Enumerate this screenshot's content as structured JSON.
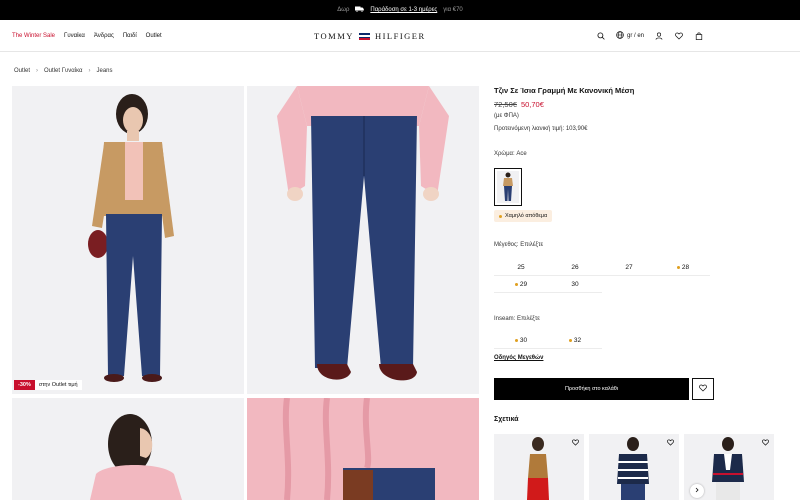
{
  "promo_bar": {
    "left": "Δωρ",
    "link": "Παράδοση σε 1-3 ημέρες",
    "right": "για €70"
  },
  "nav": {
    "sale": "The Winter Sale",
    "women": "Γυναίκα",
    "men": "Άνδρας",
    "kids": "Παιδί",
    "outlet": "Outlet"
  },
  "logo": {
    "left": "TOMMY",
    "right": "HILFIGER",
    "flag_colors": [
      "#0a2a6b",
      "#ffffff",
      "#c8102e"
    ]
  },
  "header_icons": {
    "lang": "gr / en",
    "icons": [
      "search-icon",
      "globe-icon",
      "account-icon",
      "heart-icon",
      "bag-icon"
    ]
  },
  "breadcrumb": [
    "Outlet",
    "Outlet Γυναίκα",
    "Jeans"
  ],
  "gallery_promo": {
    "badge": "-30%",
    "text": "στην Outlet τιμή"
  },
  "product": {
    "title": "Τζιν Σε Ίσια Γραμμή Με Κανονική Μέση",
    "old_price": "72,50€",
    "new_price": "50,70€",
    "vat": "(με ΦΠΑ)",
    "rrp": "Προτεινόμενη λιανική τιμή: 103,90€",
    "color_label": "Χρώμα: Ace",
    "stock": "Χαμηλό απόθεμα",
    "size_label": "Μέγεθος: Επιλέξτε",
    "sizes": [
      {
        "label": "25",
        "low": false
      },
      {
        "label": "26",
        "low": false
      },
      {
        "label": "27",
        "low": false
      },
      {
        "label": "28",
        "low": true
      },
      {
        "label": "29",
        "low": true
      },
      {
        "label": "30",
        "low": false
      }
    ],
    "inseam_label": "Inseam: Επιλέξτε",
    "inseams": [
      {
        "label": "30",
        "low": true
      },
      {
        "label": "32",
        "low": true
      }
    ],
    "size_guide": "Οδηγός Μεγεθών",
    "add_to_bag": "Προσθήκη στο καλάθι",
    "related_label": "Σχετικά"
  },
  "colors": {
    "sale": "#c8102e",
    "low_stock": "#e0a020",
    "stock_bg": "#fbeee0",
    "denim": "#2a3f73",
    "camel": "#c79a63",
    "pink": "#f2b8c0"
  }
}
